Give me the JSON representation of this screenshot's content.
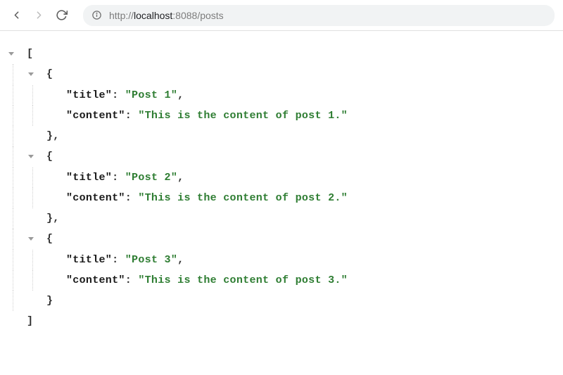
{
  "toolbar": {
    "url_scheme": "http://",
    "url_host": "localhost",
    "url_portpath": ":8088/posts"
  },
  "json": {
    "open_bracket": "[",
    "close_bracket": "]",
    "open_brace": "{",
    "close_brace_comma": "},",
    "close_brace": "}",
    "key_title": "\"title\"",
    "key_content": "\"content\"",
    "colon_sp": ": ",
    "comma": ",",
    "posts": [
      {
        "title": "\"Post 1\"",
        "content": "\"This is the content of post 1.\""
      },
      {
        "title": "\"Post 2\"",
        "content": "\"This is the content of post 2.\""
      },
      {
        "title": "\"Post 3\"",
        "content": "\"This is the content of post 3.\""
      }
    ]
  }
}
